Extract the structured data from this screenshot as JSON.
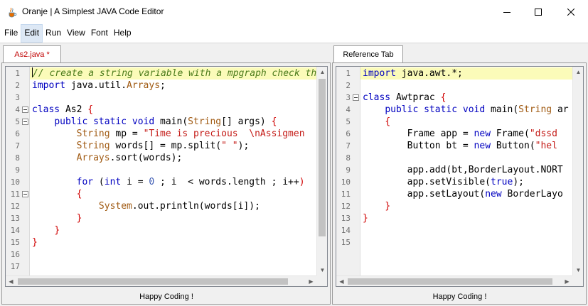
{
  "window": {
    "title": "Oranje | A Simplest JAVA Code Editor"
  },
  "menu": [
    "File",
    "Edit",
    "Run",
    "View",
    "Font",
    "Help"
  ],
  "left_pane": {
    "tab_label": "As2.java *",
    "line_numbers": [
      "1",
      "2",
      "3",
      "4",
      "5",
      "6",
      "7",
      "8",
      "9",
      "10",
      "11",
      "12",
      "13",
      "14",
      "15",
      "16",
      "17"
    ],
    "status": "Happy Coding !"
  },
  "right_pane": {
    "tab_label": "Reference Tab",
    "line_numbers": [
      "1",
      "2",
      "3",
      "4",
      "5",
      "6",
      "7",
      "8",
      "9",
      "10",
      "11",
      "12",
      "13",
      "14",
      "15"
    ],
    "status": "Happy Coding !"
  },
  "left_code": [
    [
      {
        "t": "// create a string variable with a mpgraph check th",
        "c": "cm"
      }
    ],
    [
      {
        "t": "import",
        "c": "kw"
      },
      {
        "t": " java.util."
      },
      {
        "t": "Arrays",
        "c": "ty"
      },
      {
        "t": ";"
      }
    ],
    [
      {
        "t": ""
      }
    ],
    [
      {
        "t": "class",
        "c": "kw"
      },
      {
        "t": " As2 "
      },
      {
        "t": "{",
        "c": "br"
      }
    ],
    [
      {
        "t": "    "
      },
      {
        "t": "public static void",
        "c": "kw"
      },
      {
        "t": " main("
      },
      {
        "t": "String",
        "c": "ty"
      },
      {
        "t": "[] args) "
      },
      {
        "t": "{",
        "c": "br"
      }
    ],
    [
      {
        "t": "        "
      },
      {
        "t": "String",
        "c": "ty"
      },
      {
        "t": " mp = "
      },
      {
        "t": "\"Time is precious  \\nAssigmen",
        "c": "st"
      }
    ],
    [
      {
        "t": "        "
      },
      {
        "t": "String",
        "c": "ty"
      },
      {
        "t": " words[] = mp.split("
      },
      {
        "t": "\" \"",
        "c": "st"
      },
      {
        "t": ");"
      }
    ],
    [
      {
        "t": "        "
      },
      {
        "t": "Arrays",
        "c": "ty"
      },
      {
        "t": ".sort(words);"
      }
    ],
    [
      {
        "t": ""
      }
    ],
    [
      {
        "t": "        "
      },
      {
        "t": "for",
        "c": "kw"
      },
      {
        "t": " ("
      },
      {
        "t": "int",
        "c": "kw"
      },
      {
        "t": " i = "
      },
      {
        "t": "0",
        "c": "nu"
      },
      {
        "t": " ; i  < words.length ; i++"
      },
      {
        "t": ")",
        "c": "br"
      }
    ],
    [
      {
        "t": "        "
      },
      {
        "t": "{",
        "c": "br"
      }
    ],
    [
      {
        "t": "            "
      },
      {
        "t": "System",
        "c": "ty"
      },
      {
        "t": ".out.println(words[i]);"
      }
    ],
    [
      {
        "t": "        "
      },
      {
        "t": "}",
        "c": "br"
      }
    ],
    [
      {
        "t": "    "
      },
      {
        "t": "}",
        "c": "br"
      }
    ],
    [
      {
        "t": "}",
        "c": "br"
      }
    ],
    [
      {
        "t": ""
      }
    ],
    [
      {
        "t": ""
      }
    ]
  ],
  "right_code": [
    [
      {
        "t": "import",
        "c": "kw"
      },
      {
        "t": " java.awt.*;"
      }
    ],
    [
      {
        "t": ""
      }
    ],
    [
      {
        "t": "class",
        "c": "kw"
      },
      {
        "t": " Awtprac "
      },
      {
        "t": "{",
        "c": "br"
      }
    ],
    [
      {
        "t": "    "
      },
      {
        "t": "public static void",
        "c": "kw"
      },
      {
        "t": " main("
      },
      {
        "t": "String",
        "c": "ty"
      },
      {
        "t": " ar"
      }
    ],
    [
      {
        "t": "    "
      },
      {
        "t": "{",
        "c": "br"
      }
    ],
    [
      {
        "t": "        Frame app = "
      },
      {
        "t": "new",
        "c": "kw"
      },
      {
        "t": " Frame("
      },
      {
        "t": "\"dssd",
        "c": "st"
      }
    ],
    [
      {
        "t": "        Button bt = "
      },
      {
        "t": "new",
        "c": "kw"
      },
      {
        "t": " Button("
      },
      {
        "t": "\"hel",
        "c": "st"
      }
    ],
    [
      {
        "t": ""
      }
    ],
    [
      {
        "t": "        app.add(bt,BorderLayout.NORT"
      }
    ],
    [
      {
        "t": "        app.setVisible("
      },
      {
        "t": "true",
        "c": "kw"
      },
      {
        "t": ");"
      }
    ],
    [
      {
        "t": "        app.setLayout("
      },
      {
        "t": "new",
        "c": "kw"
      },
      {
        "t": " BorderLayo"
      }
    ],
    [
      {
        "t": "    "
      },
      {
        "t": "}",
        "c": "br"
      }
    ],
    [
      {
        "t": "}",
        "c": "br"
      }
    ],
    [
      {
        "t": ""
      }
    ],
    [
      {
        "t": ""
      }
    ]
  ],
  "colors": {
    "keyword": "#0000c0",
    "type": "#a05a12",
    "string": "#c41a16",
    "comment": "#4a7a1a",
    "brace": "#d00000",
    "current_line": "#fbfbb9",
    "modified_tab": "#c00000"
  },
  "icons": {
    "app": "java-cup-icon",
    "minimize": "minimize-icon",
    "maximize": "maximize-icon",
    "close": "close-icon"
  }
}
